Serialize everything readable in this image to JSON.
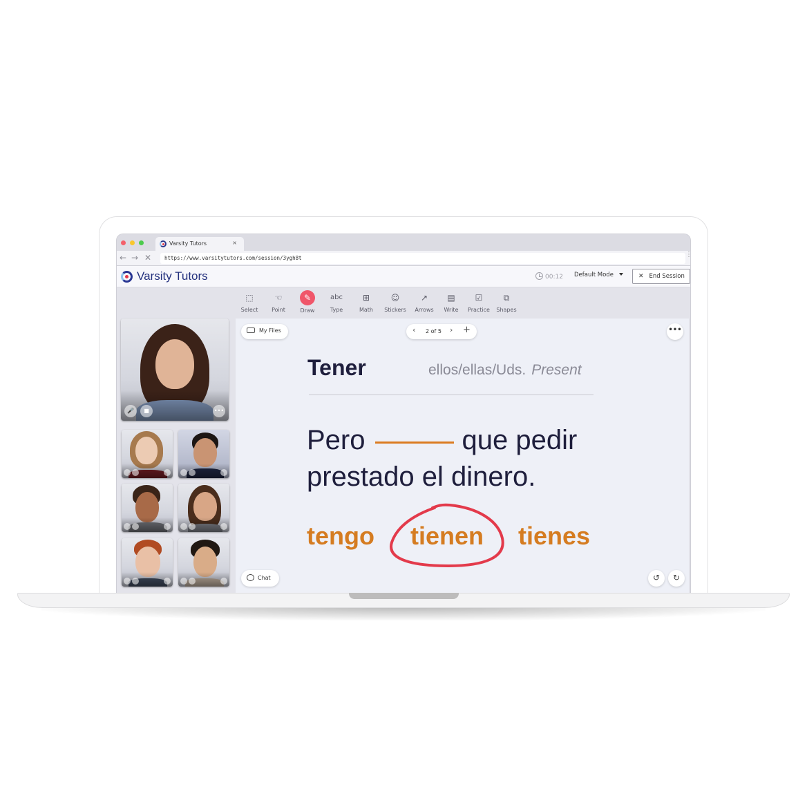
{
  "browser": {
    "tab_title": "Varsity Tutors",
    "tab_close": "×",
    "url": "https://www.varsitytutors.com/session/3ygh8t",
    "nav": {
      "back": "←",
      "forward": "→",
      "stop": "✕",
      "menu": "⋮"
    }
  },
  "header": {
    "brand": "Varsity Tutors",
    "timer": "00:12",
    "mode": "Default Mode",
    "end_session": "End Session",
    "end_icon": "✕"
  },
  "toolbar": {
    "active": "Draw",
    "tools": [
      {
        "label": "Select",
        "icon": "⬚"
      },
      {
        "label": "Point",
        "icon": "☜"
      },
      {
        "label": "Draw",
        "icon": "✎"
      },
      {
        "label": "Type",
        "icon": "abc"
      },
      {
        "label": "Math",
        "icon": "⊞"
      },
      {
        "label": "Stickers",
        "icon": "☺"
      },
      {
        "label": "Arrows",
        "icon": "↗"
      },
      {
        "label": "Write",
        "icon": "▤"
      },
      {
        "label": "Practice",
        "icon": "☑"
      },
      {
        "label": "Shapes",
        "icon": "⧉"
      }
    ]
  },
  "video": {
    "main_controls": {
      "mic": "🎤",
      "camera": "■",
      "more": "•••"
    },
    "participants": 6
  },
  "board": {
    "my_files": "My Files",
    "page": {
      "current": 2,
      "total": 5,
      "label": "2 of 5",
      "prev": "‹",
      "next": "›",
      "add": "+"
    },
    "more": "•••",
    "chat": "Chat",
    "undo": "↺",
    "redo": "↻",
    "card": {
      "title": "Tener",
      "subject": "ellos/ellas/Uds.",
      "tense": "Present",
      "sentence_start": "Pero",
      "sentence_end": "que pedir prestado el dinero.",
      "choices": [
        "tengo",
        "tienen",
        "tienes"
      ],
      "circled_choice": "tienen"
    },
    "colors": {
      "answer": "#d57c21",
      "annotation": "#e33a4b",
      "draw_active": "#f0566a"
    }
  }
}
